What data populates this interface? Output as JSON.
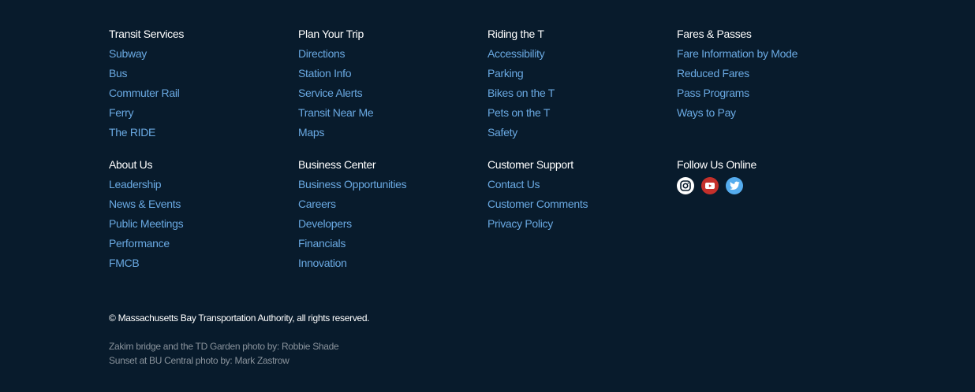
{
  "footer": {
    "sections": [
      {
        "heading": "Transit Services",
        "links": [
          "Subway",
          "Bus",
          "Commuter Rail",
          "Ferry",
          "The RIDE"
        ]
      },
      {
        "heading": "Plan Your Trip",
        "links": [
          "Directions",
          "Station Info",
          "Service Alerts",
          "Transit Near Me",
          "Maps"
        ]
      },
      {
        "heading": "Riding the T",
        "links": [
          "Accessibility",
          "Parking",
          "Bikes on the T",
          "Pets on the T",
          "Safety"
        ]
      },
      {
        "heading": "Fares & Passes",
        "links": [
          "Fare Information by Mode",
          "Reduced Fares",
          "Pass Programs",
          "Ways to Pay"
        ]
      },
      {
        "heading": "About Us",
        "links": [
          "Leadership",
          "News & Events",
          "Public Meetings",
          "Performance",
          "FMCB"
        ]
      },
      {
        "heading": "Business Center",
        "links": [
          "Business Opportunities",
          "Careers",
          "Developers",
          "Financials",
          "Innovation"
        ]
      },
      {
        "heading": "Customer Support",
        "links": [
          "Contact Us",
          "Customer Comments",
          "Privacy Policy"
        ]
      }
    ],
    "follow": {
      "heading": "Follow Us Online",
      "icons": [
        "instagram-icon",
        "youtube-icon",
        "twitter-icon"
      ]
    },
    "copyright": "© Massachusetts Bay Transportation Authority, all rights reserved.",
    "credits": [
      "Zakim bridge and the TD Garden photo by: Robbie Shade",
      "Sunset at BU Central photo by: Mark Zastrow"
    ]
  },
  "colors": {
    "background": "#081b2c",
    "link": "#6aa9e2",
    "heading": "#ffffff",
    "credits": "#8a939c",
    "youtube": "#c4302b",
    "twitter": "#55acee"
  }
}
